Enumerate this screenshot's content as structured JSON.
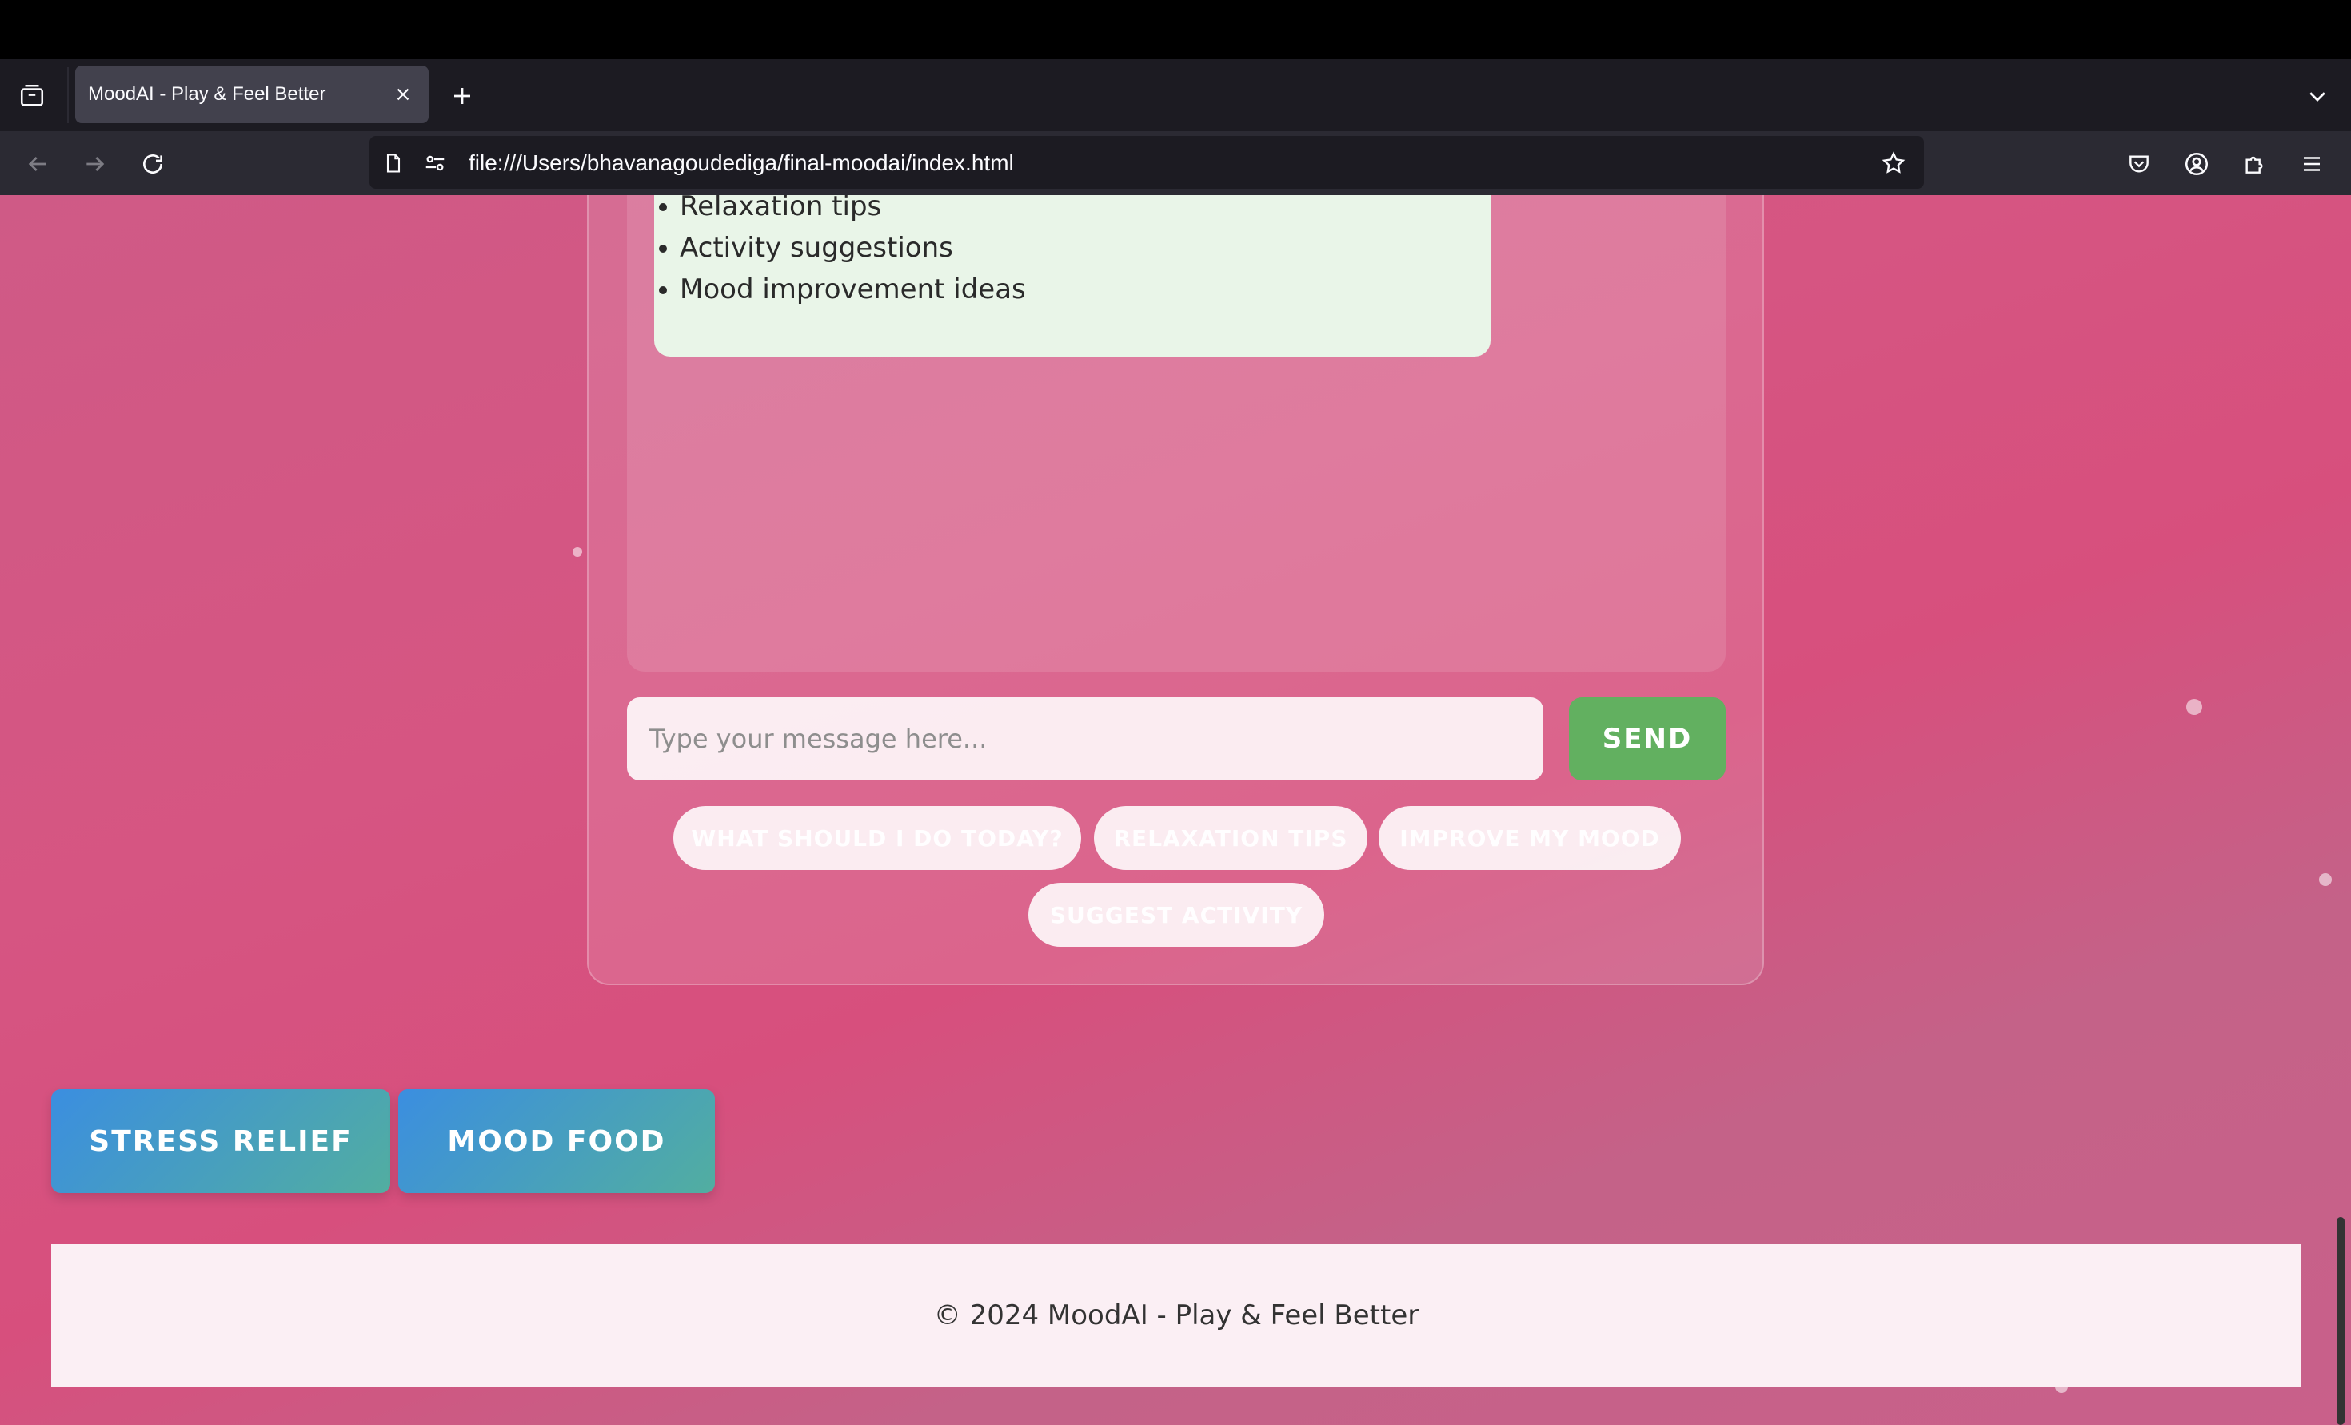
{
  "browser": {
    "tab_title": "MoodAI - Play & Feel Better",
    "url": "file:///Users/bhavanagoudediga/final-moodai/index.html"
  },
  "chat": {
    "bot_message_items": [
      "Relaxation tips",
      "Activity suggestions",
      "Mood improvement ideas"
    ],
    "input_placeholder": "Type your message here...",
    "send_label": "SEND",
    "quick_replies": [
      "WHAT SHOULD I DO TODAY?",
      "RELAXATION TIPS",
      "IMPROVE MY MOOD",
      "SUGGEST ACTIVITY"
    ]
  },
  "features": {
    "stress_relief_label": "STRESS RELIEF",
    "mood_food_label": "MOOD FOOD"
  },
  "footer": {
    "text": "© 2024 MoodAI - Play & Feel Better"
  },
  "colors": {
    "send_button": "#62b060",
    "feature_gradient_start": "#3b8ee0",
    "feature_gradient_end": "#52aea0",
    "bot_bubble": "#e9f5e8"
  }
}
